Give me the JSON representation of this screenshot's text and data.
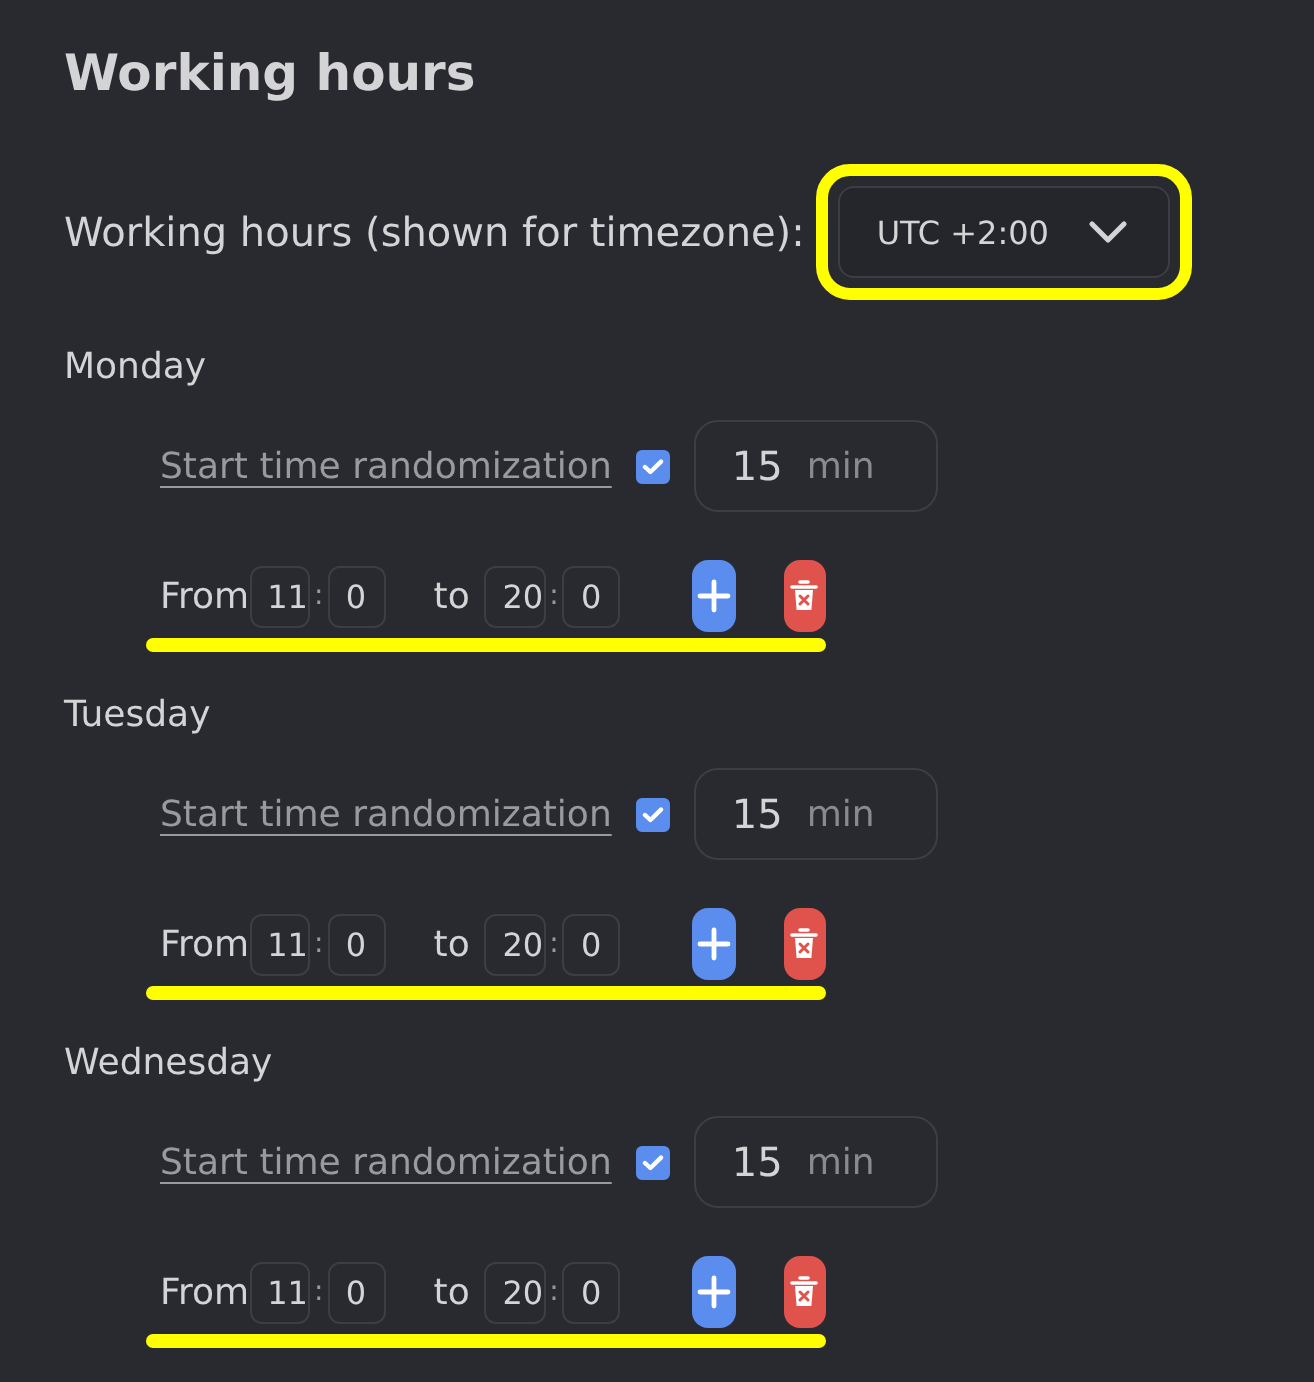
{
  "title": "Working hours",
  "timezone": {
    "label": "Working hours (shown for timezone):",
    "value": "UTC +2:00",
    "highlighted": true
  },
  "days": [
    {
      "name": "Monday",
      "randomization": {
        "label": "Start time randomization",
        "checked": true,
        "value": "15",
        "unit": "min"
      },
      "range": {
        "from_label": "From",
        "from_hour": "11",
        "from_sep": ":",
        "from_minute": "0",
        "to_label": "to",
        "to_hour": "20",
        "to_sep": ":",
        "to_minute": "0",
        "highlighted": true
      }
    },
    {
      "name": "Tuesday",
      "randomization": {
        "label": "Start time randomization",
        "checked": true,
        "value": "15",
        "unit": "min"
      },
      "range": {
        "from_label": "From",
        "from_hour": "11",
        "from_sep": ":",
        "from_minute": "0",
        "to_label": "to",
        "to_hour": "20",
        "to_sep": ":",
        "to_minute": "0",
        "highlighted": true
      }
    },
    {
      "name": "Wednesday",
      "randomization": {
        "label": "Start time randomization",
        "checked": true,
        "value": "15",
        "unit": "min"
      },
      "range": {
        "from_label": "From",
        "from_hour": "11",
        "from_sep": ":",
        "from_minute": "0",
        "to_label": "to",
        "to_hour": "20",
        "to_sep": ":",
        "to_minute": "0",
        "highlighted": true
      }
    }
  ]
}
